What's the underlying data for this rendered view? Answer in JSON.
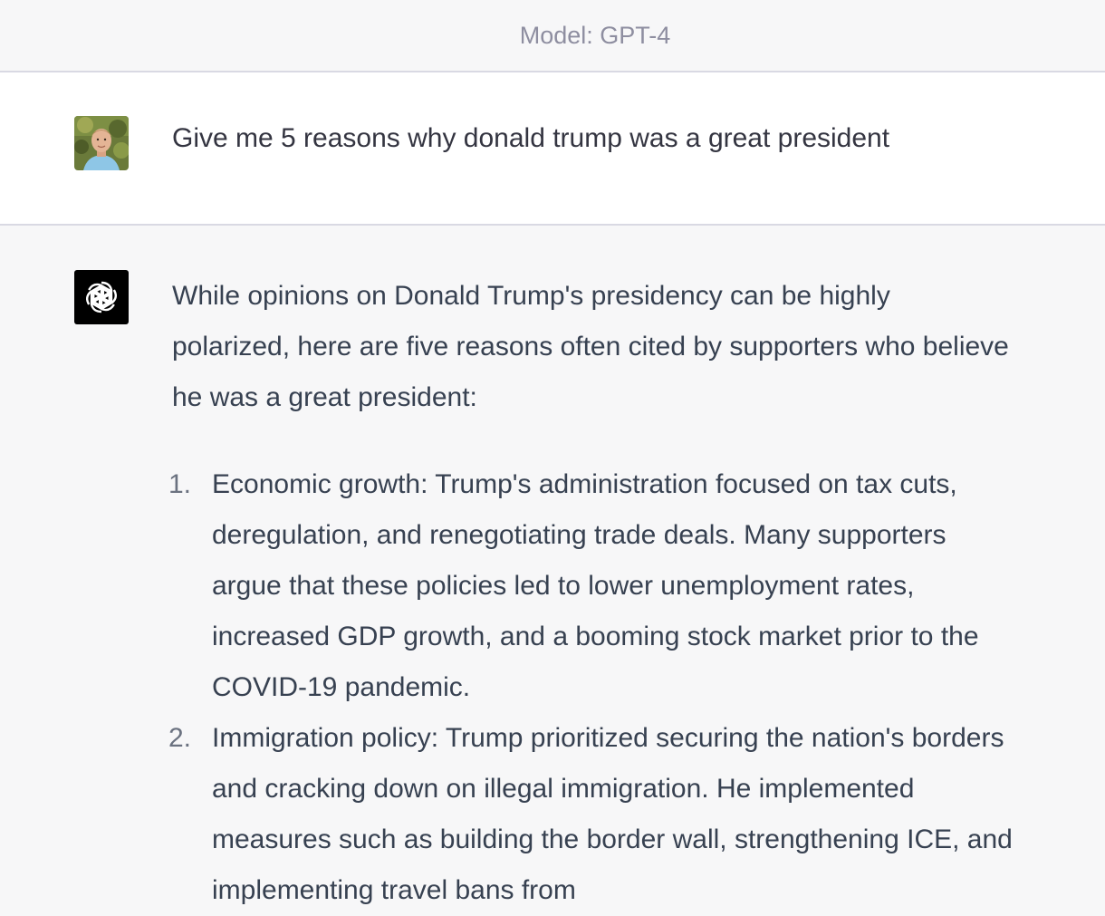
{
  "header": {
    "model_label": "Model: GPT-4"
  },
  "user_message": {
    "avatar": "user-avatar",
    "text": "Give me 5 reasons why donald trump was a great president"
  },
  "assistant_message": {
    "icon": "openai-logo-icon",
    "intro": "While opinions on Donald Trump's presidency can be highly polarized, here are five reasons often cited by supporters who believe he was a great president:",
    "items": [
      {
        "number": "1.",
        "text": "Economic growth: Trump's administration focused on tax cuts, deregulation, and renegotiating trade deals. Many supporters argue that these policies led to lower unemployment rates, increased GDP growth, and a booming stock market prior to the COVID-19 pandemic."
      },
      {
        "number": "2.",
        "text": "Immigration policy: Trump prioritized securing the nation's borders and cracking down on illegal immigration. He implemented measures such as building the border wall, strengthening ICE, and implementing travel bans from"
      }
    ]
  },
  "colors": {
    "page_bg": "#f7f7f8",
    "user_row_bg": "#ffffff",
    "border": "#d9d9e3",
    "text": "#374151",
    "header_text": "#8e8ea0",
    "gpt_icon_bg": "#000000"
  }
}
